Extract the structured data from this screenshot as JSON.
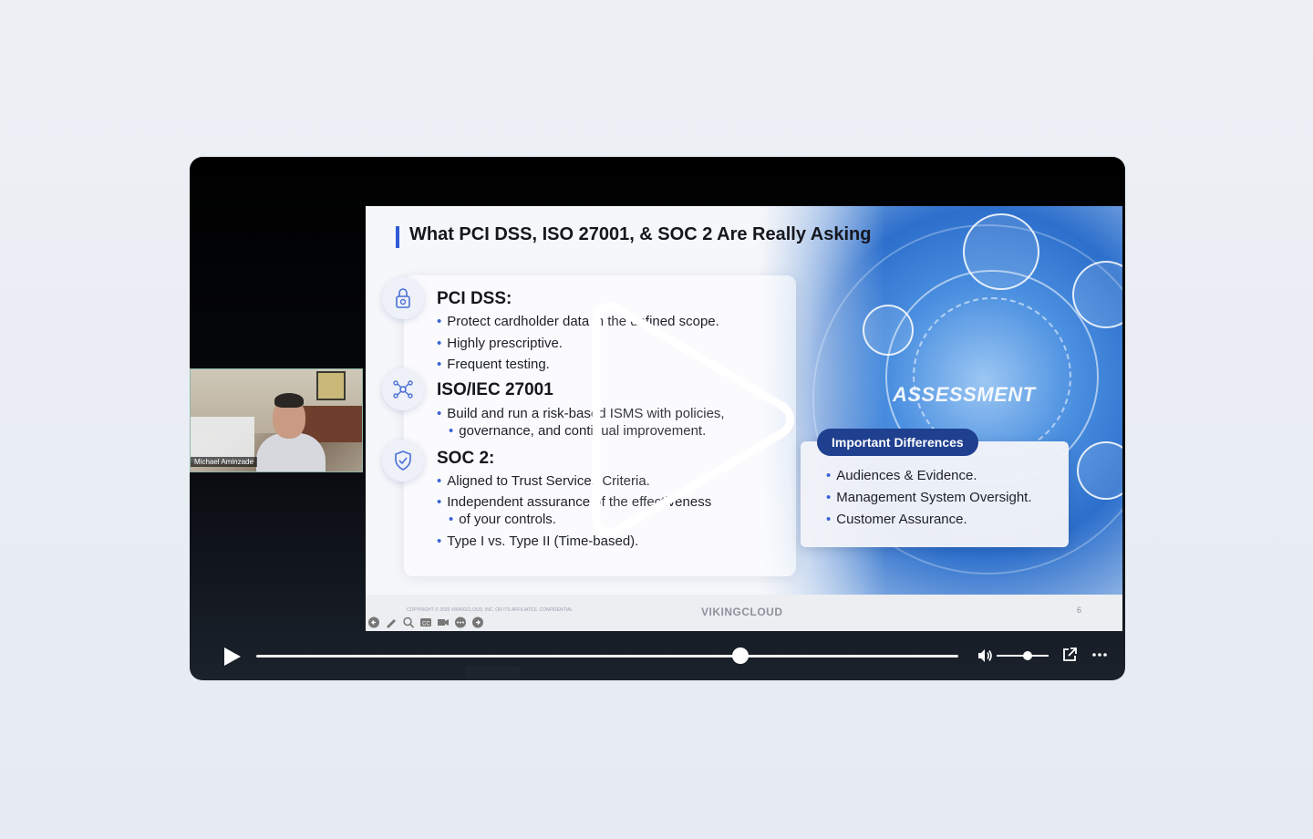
{
  "slide": {
    "title": "What PCI DSS, ISO 27001, & SOC 2 Are Really Asking",
    "sections": [
      {
        "heading": "PCI DSS:",
        "icon": "lock-gear-icon",
        "bullets": [
          "Protect cardholder data in the defined scope.",
          "Highly prescriptive.",
          "Frequent testing."
        ]
      },
      {
        "heading": "ISO/IEC 27001",
        "icon": "network-icon",
        "bullets": [
          "Build and run a risk-based ISMS with policies,",
          "governance, and continual improvement."
        ]
      },
      {
        "heading": "SOC 2:",
        "icon": "shield-check-icon",
        "bullets": [
          "Aligned to Trust Services Criteria.",
          "Independent assurance of the effectiveness",
          "of your controls.",
          "Type I vs. Type II (Time-based)."
        ]
      }
    ],
    "art_label": "ASSESSMENT",
    "differences": {
      "title": "Important Differences",
      "items": [
        "Audiences & Evidence.",
        "Management System Oversight.",
        "Customer Assurance."
      ]
    },
    "footer": {
      "copyright": "COPYRIGHT © 2026 VIKINGCLOUD, INC. OR ITS AFFILIATES. CONFIDENTIAL",
      "brand": "VIKINGCLOUD",
      "page": "6"
    }
  },
  "webcam": {
    "name": "Michael Aminzade"
  },
  "player": {
    "progress": 0.69,
    "volume": 0.6,
    "colors": {
      "bar": "#ffffff",
      "background": "#000000"
    }
  }
}
